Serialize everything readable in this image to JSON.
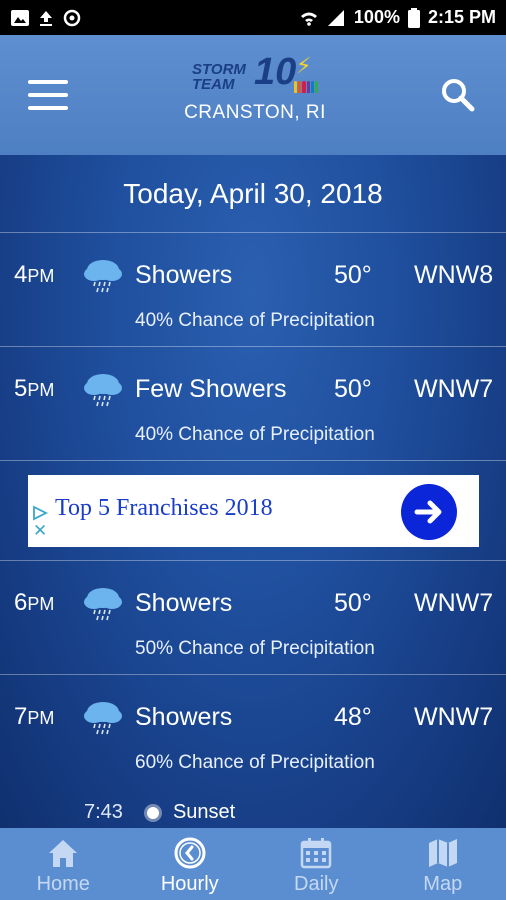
{
  "status_bar": {
    "battery": "100%",
    "time": "2:15 PM"
  },
  "header": {
    "logo_line1": "STORM",
    "logo_line2": "TEAM",
    "logo_number": "10",
    "location": "CRANSTON, RI"
  },
  "date_heading": "Today, April 30, 2018",
  "hours": [
    {
      "hour": "4",
      "ampm": "PM",
      "icon": "showers-icon",
      "condition": "Showers",
      "temp": "50°",
      "wind": "WNW8",
      "precip": "40% Chance of Precipitation"
    },
    {
      "hour": "5",
      "ampm": "PM",
      "icon": "showers-icon",
      "condition": "Few Showers",
      "temp": "50°",
      "wind": "WNW7",
      "precip": "40% Chance of Precipitation"
    },
    {
      "hour": "6",
      "ampm": "PM",
      "icon": "showers-icon",
      "condition": "Showers",
      "temp": "50°",
      "wind": "WNW7",
      "precip": "50% Chance of Precipitation"
    },
    {
      "hour": "7",
      "ampm": "PM",
      "icon": "showers-icon",
      "condition": "Showers",
      "temp": "48°",
      "wind": "WNW7",
      "precip": "60% Chance of Precipitation"
    }
  ],
  "ad": {
    "text": "Top 5 Franchises 2018",
    "close_glyph": "✕"
  },
  "sunset": {
    "time": "7:43",
    "label": "Sunset"
  },
  "nav": {
    "items": [
      {
        "label": "Home",
        "icon": "home-icon",
        "active": false
      },
      {
        "label": "Hourly",
        "icon": "clock-icon",
        "active": true
      },
      {
        "label": "Daily",
        "icon": "calendar-icon",
        "active": false
      },
      {
        "label": "Map",
        "icon": "map-icon",
        "active": false
      }
    ]
  },
  "colors": {
    "header_bg": "#5a8bd0",
    "nav_bg": "#5b8ed1",
    "ad_text": "#1a3dc9",
    "ad_button": "#0b25d8"
  }
}
